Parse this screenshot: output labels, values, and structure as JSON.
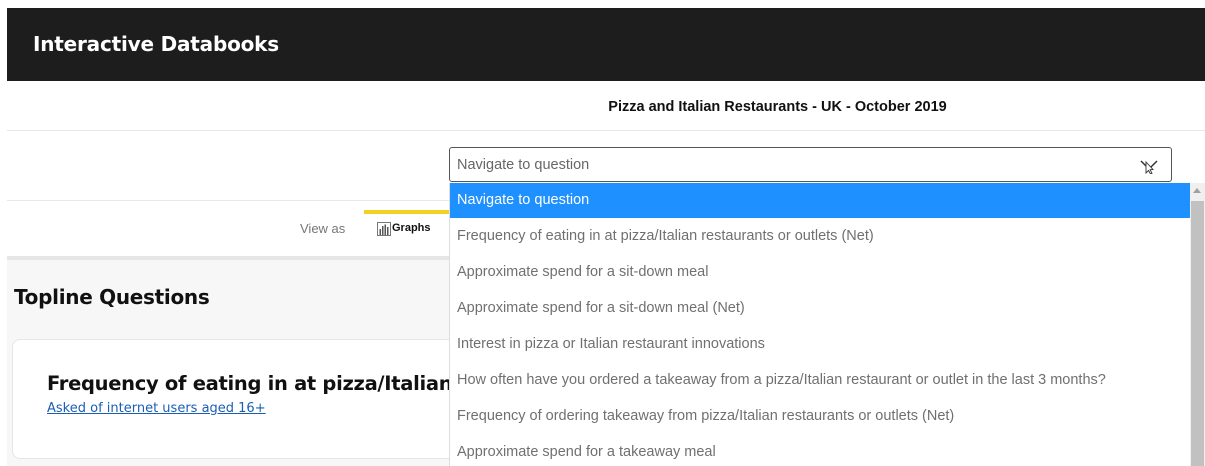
{
  "header": {
    "app_title": "Interactive Databooks"
  },
  "report": {
    "title": "Pizza and Italian Restaurants - UK - October 2019"
  },
  "navigator": {
    "selected_value": "Navigate to question",
    "options": [
      "Navigate to question",
      "Frequency of eating in at pizza/Italian restaurants or outlets (Net)",
      "Approximate spend for a sit-down meal",
      "Approximate spend for a sit-down meal (Net)",
      "Interest in pizza or Italian restaurant innovations",
      "How often have you ordered a takeaway from a pizza/Italian restaurant or outlet in the last 3 months?",
      "Frequency of ordering takeaway from pizza/Italian restaurants or outlets (Net)",
      "Approximate spend for a takeaway meal"
    ],
    "highlight_color": "#1e90ff"
  },
  "view": {
    "label": "View as",
    "active_tab": "Graphs",
    "accent_color": "#f2d024"
  },
  "section": {
    "title": "Topline Questions"
  },
  "card": {
    "title": "Frequency of eating in at pizza/Italian rest",
    "subtitle": "Asked of internet users aged 16+"
  }
}
